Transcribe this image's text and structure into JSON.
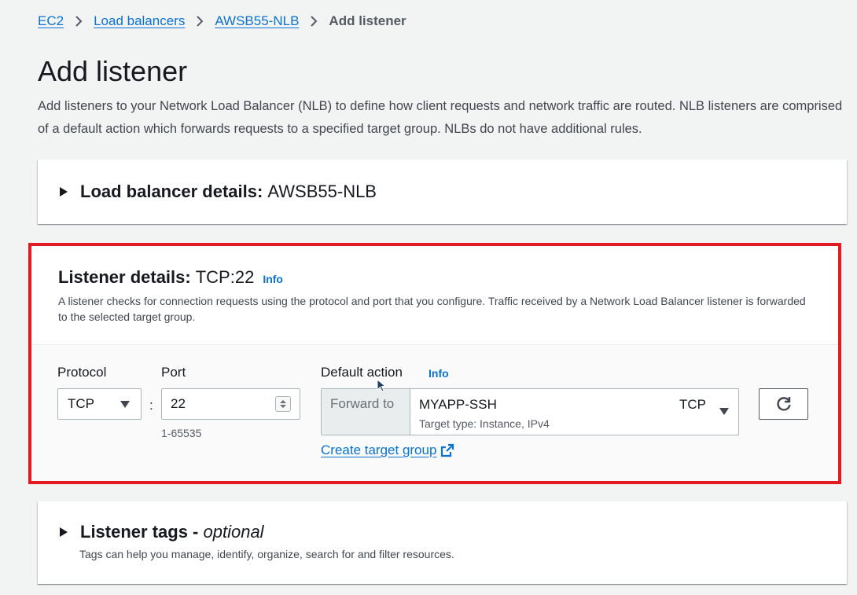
{
  "breadcrumb": {
    "items": [
      "EC2",
      "Load balancers",
      "AWSB55-NLB"
    ],
    "current": "Add listener"
  },
  "page": {
    "title": "Add listener",
    "description": "Add listeners to your Network Load Balancer (NLB) to define how client requests and network traffic are routed. NLB listeners are comprised of a default action which forwards requests to a specified target group. NLBs do not have additional rules."
  },
  "lb_details": {
    "label": "Load balancer details:",
    "value": "AWSB55-NLB"
  },
  "listener": {
    "title": "Listener details:",
    "title_value": "TCP:22",
    "info": "Info",
    "description": "A listener checks for connection requests using the protocol and port that you configure. Traffic received by a Network Load Balancer listener is forwarded to the selected target group.",
    "protocol_label": "Protocol",
    "protocol_value": "TCP",
    "port_label": "Port",
    "port_value": "22",
    "port_hint": "1-65535",
    "colon": ":",
    "default_action_label": "Default action",
    "default_action_info": "Info",
    "forward_to": "Forward to",
    "target_group_name": "MYAPP-SSH",
    "target_group_protocol": "TCP",
    "target_group_type": "Target type: Instance, IPv4",
    "create_target_group": "Create target group"
  },
  "tags": {
    "title": "Listener tags -",
    "optional": "optional",
    "description": "Tags can help you manage, identify, organize, search for and filter resources."
  },
  "colors": {
    "link": "#0972d3",
    "highlight_border": "#e21b23",
    "background": "#f2f3f3"
  },
  "icons": [
    "chevron-right-icon",
    "caret-right-icon",
    "caret-down-icon",
    "stepper-icon",
    "external-link-icon",
    "refresh-icon",
    "mouse-cursor-icon"
  ]
}
